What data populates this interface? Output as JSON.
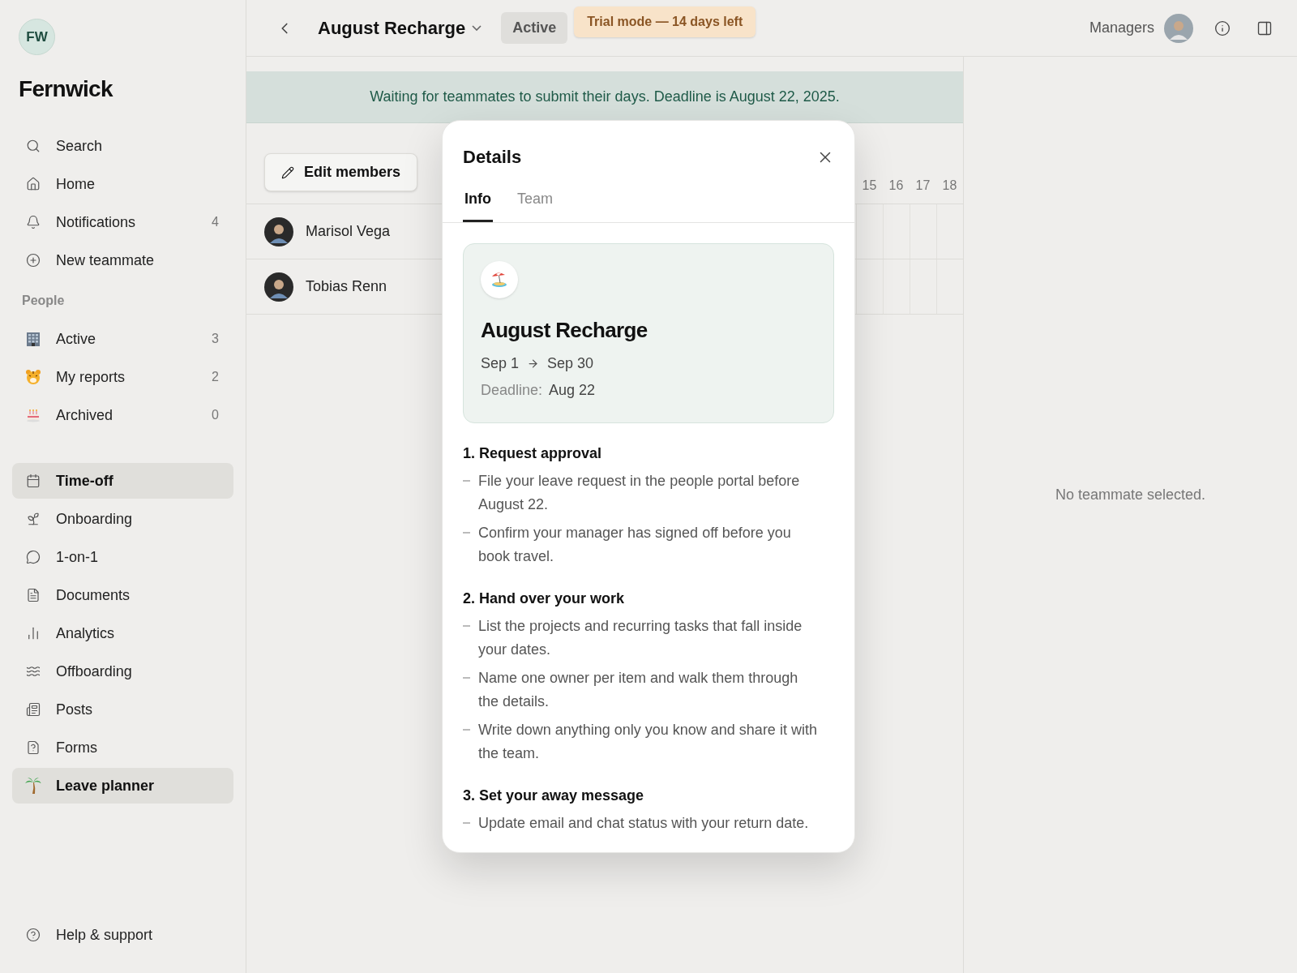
{
  "sidebar": {
    "initials": "FW",
    "workspace": "Fernwick",
    "nav": [
      {
        "label": "Search"
      },
      {
        "label": "Home"
      },
      {
        "label": "Notifications",
        "count": "4"
      },
      {
        "label": "New teammate"
      }
    ],
    "section": "People",
    "people": [
      {
        "label": "Active",
        "count": "3"
      },
      {
        "label": "My reports",
        "count": "2"
      },
      {
        "label": "Archived",
        "count": "0"
      }
    ],
    "apps": [
      {
        "label": "Time-off",
        "selected": true
      },
      {
        "label": "Onboarding",
        "selected": false
      },
      {
        "label": "1-on-1",
        "selected": false
      },
      {
        "label": "Documents",
        "selected": false
      },
      {
        "label": "Analytics",
        "selected": false
      },
      {
        "label": "Offboarding",
        "selected": false
      },
      {
        "label": "Posts",
        "selected": false
      },
      {
        "label": "Forms",
        "selected": false
      },
      {
        "label": "Leave planner",
        "selected": true
      }
    ],
    "footer": "Help & support"
  },
  "header": {
    "title": "August Recharge",
    "status": "Active",
    "trial": "Trial mode — 14 days left",
    "audience": "Managers"
  },
  "banner": "Waiting for teammates to submit their days. Deadline is August 22, 2025.",
  "planner": {
    "edit_button": "Edit members",
    "days": [
      "15",
      "16",
      "17",
      "18"
    ],
    "members": [
      {
        "name": "Marisol Vega"
      },
      {
        "name": "Tobias Renn"
      }
    ]
  },
  "details": {
    "title": "Details",
    "tabs": [
      {
        "label": "Info",
        "selected": true
      },
      {
        "label": "Team",
        "selected": false
      }
    ],
    "card": {
      "title": "August Recharge",
      "start": "Sep 1",
      "end": "Sep 30",
      "deadline_label": "Deadline:",
      "deadline": "Aug 22"
    },
    "sections": [
      {
        "heading": "1. Request approval",
        "items": [
          "File your leave request in the people portal before August 22.",
          "Confirm your manager has signed off before you book travel."
        ]
      },
      {
        "heading": "2. Hand over your work",
        "items": [
          "List the projects and recurring tasks that fall inside your dates.",
          "Name one owner per item and walk them through the details.",
          "Write down anything only you know and share it with the team."
        ]
      },
      {
        "heading": "3. Set your away message",
        "items": [
          "Update email and chat status with your return date."
        ]
      }
    ]
  },
  "side_panel": {
    "empty_text": "No teammate selected."
  }
}
